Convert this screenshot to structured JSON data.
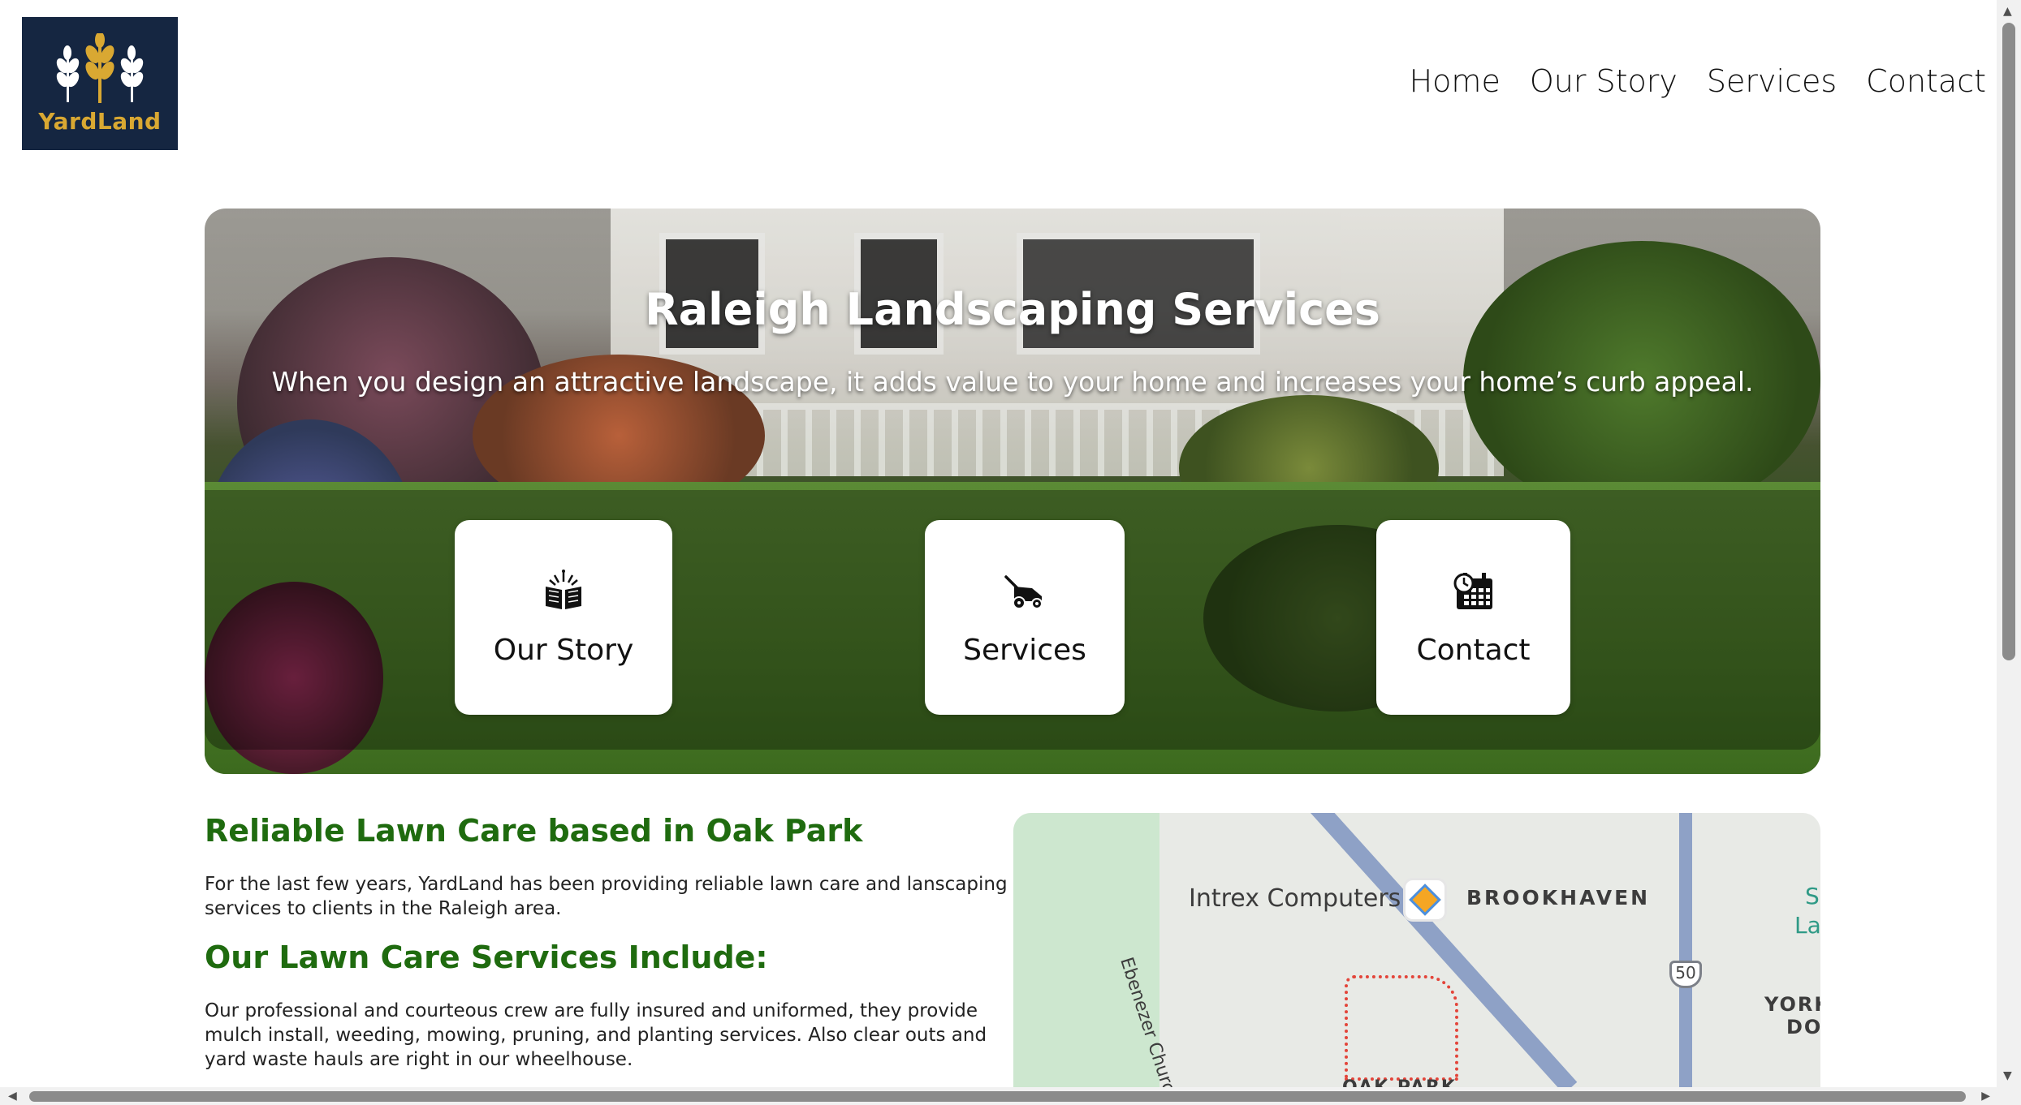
{
  "brand": {
    "name": "YardLand"
  },
  "nav": {
    "items": [
      "Home",
      "Our Story",
      "Services",
      "Contact"
    ]
  },
  "hero": {
    "title": "Raleigh Landscaping Services",
    "subtitle": "When you design an attractive landscape, it adds value to your home and increases your home’s curb appeal.",
    "cards": [
      {
        "label": "Our Story",
        "icon": "open-book-icon"
      },
      {
        "label": "Services",
        "icon": "lawn-mower-icon"
      },
      {
        "label": "Contact",
        "icon": "calendar-clock-icon"
      }
    ]
  },
  "content": {
    "heading1": "Reliable Lawn Care based in Oak Park",
    "para1": "For the last few years, YardLand has been providing reliable lawn care and lanscaping services to clients in the Raleigh area.",
    "heading2": "Our Lawn Care Services Include:",
    "para2": "Our professional and courteous crew are fully insured and uniformed, they provide mulch install, weeding, mowing, pruning, and planting services. Also clear outs and yard waste hauls are right in our wheelhouse."
  },
  "map": {
    "labels": {
      "poi": "Intrex Computers",
      "area1": "BROOKHAVEN",
      "road": "Ebenezer Church R",
      "route": "50",
      "area2a": "YORK",
      "area2b": "DO",
      "area3": "OAK PARK",
      "edge_s": "S",
      "edge_la": "La"
    }
  },
  "colors": {
    "brand_bg": "#152641",
    "brand_gold": "#d9a832",
    "heading_green": "#1f6b0f"
  }
}
